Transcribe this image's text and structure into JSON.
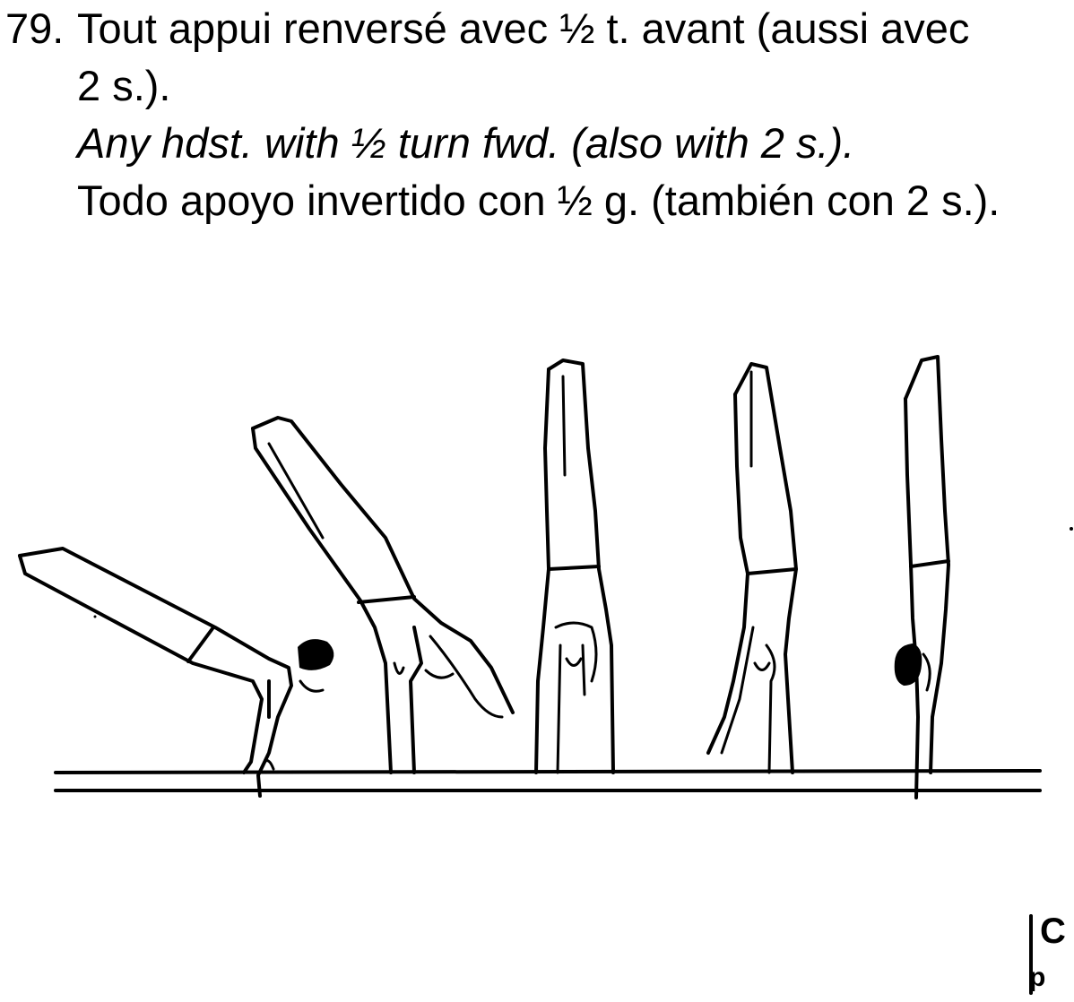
{
  "element": {
    "number": "79.",
    "french_line1": "Tout appui renversé avec ½ t. avant (aussi avec",
    "french_line2": "2 s.).",
    "english": "Any hdst. with ½ turn fwd. (also with 2 s.).",
    "spanish": "Todo apoyo invertido con ½ g. (también con 2 s.)."
  },
  "figure": {
    "subject": "handstand-sequence-on-bars",
    "positions": 5
  },
  "corner_mark": {
    "top_letter": "C",
    "bottom_letter": "p"
  }
}
